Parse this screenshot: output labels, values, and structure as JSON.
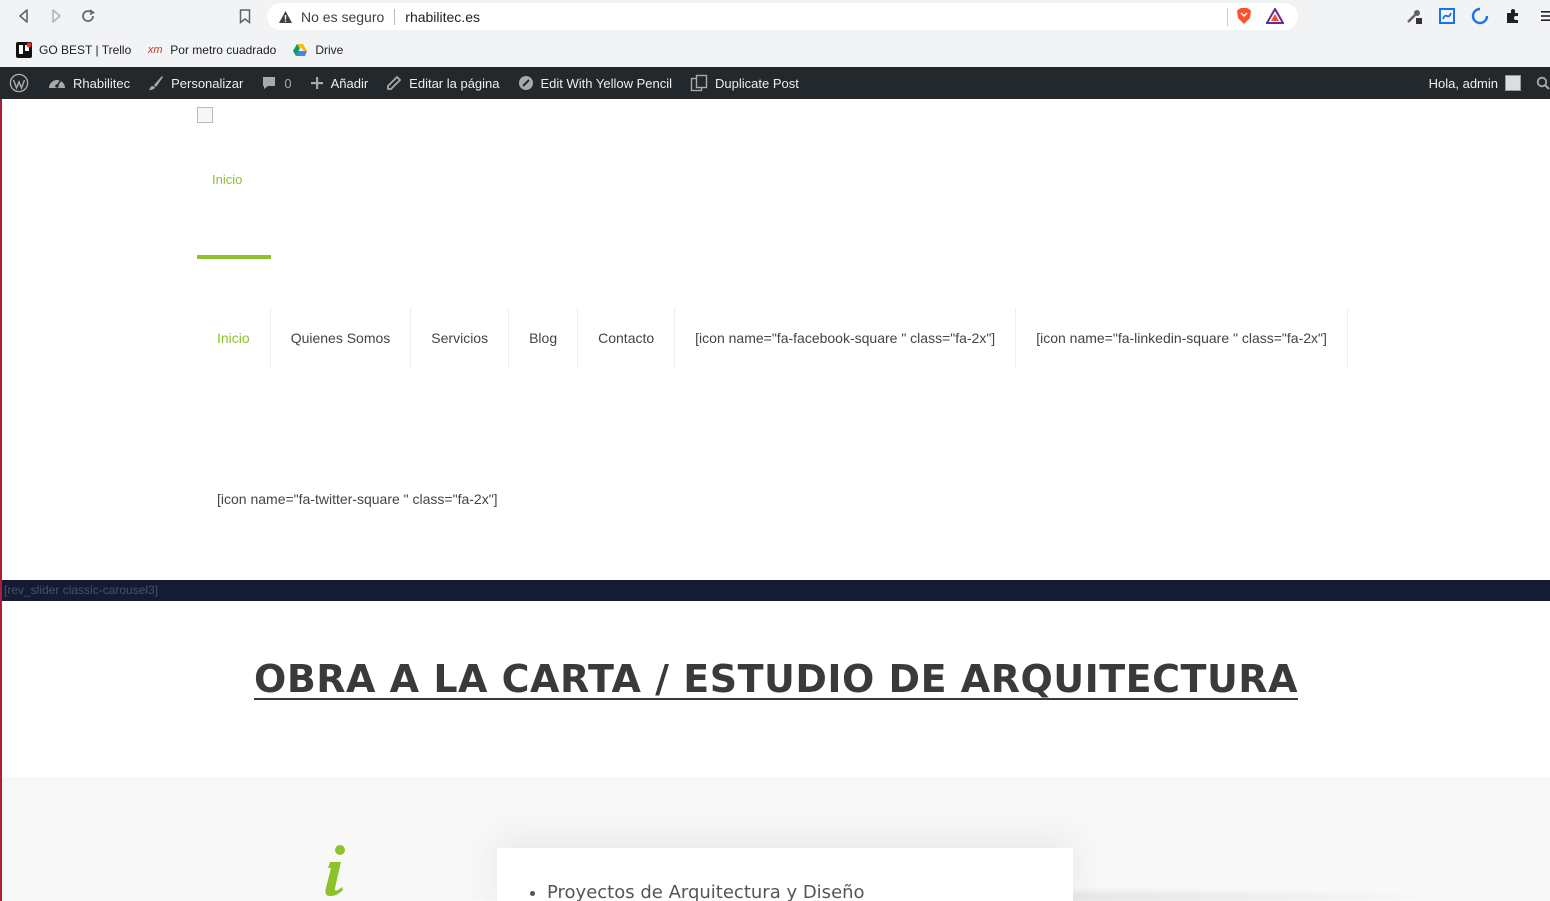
{
  "browser": {
    "security_label": "No es seguro",
    "url": "rhabilitec.es",
    "bookmarks": [
      {
        "label": "GO BEST | Trello",
        "icon": "trello-icon"
      },
      {
        "label": "Por metro cuadrado",
        "icon": "xm-icon"
      },
      {
        "label": "Drive",
        "icon": "drive-icon"
      }
    ]
  },
  "adminbar": {
    "site_name": "Rhabilitec",
    "customize": "Personalizar",
    "comments_count": "0",
    "add_new": "Añadir",
    "edit_page": "Editar la página",
    "yellow_pencil": "Edit With Yellow Pencil",
    "duplicate_post": "Duplicate Post",
    "greeting": "Hola, admin"
  },
  "header": {
    "top_link": "Inicio",
    "nav": [
      {
        "label": "Inicio",
        "active": true
      },
      {
        "label": "Quienes Somos",
        "active": false
      },
      {
        "label": "Servicios",
        "active": false
      },
      {
        "label": "Blog",
        "active": false
      },
      {
        "label": "Contacto",
        "active": false
      },
      {
        "label": "[icon name=\"fa-facebook-square \" class=\"fa-2x\"]",
        "active": false
      },
      {
        "label": "[icon name=\"fa-linkedin-square \" class=\"fa-2x\"]",
        "active": false
      }
    ],
    "twitter_shortcode": "[icon name=\"fa-twitter-square \" class=\"fa-2x\"]"
  },
  "slider_placeholder": "[rev_slider classic-carousel3]",
  "hero": {
    "title": "OBRA A LA CARTA / ESTUDIO DE ARQUITECTURA"
  },
  "services": {
    "items": [
      "Proyectos de Arquitectura y Diseño"
    ]
  },
  "colors": {
    "accent": "#8cc32b",
    "adminbar": "#23282d",
    "slider_bar": "#141b33"
  }
}
